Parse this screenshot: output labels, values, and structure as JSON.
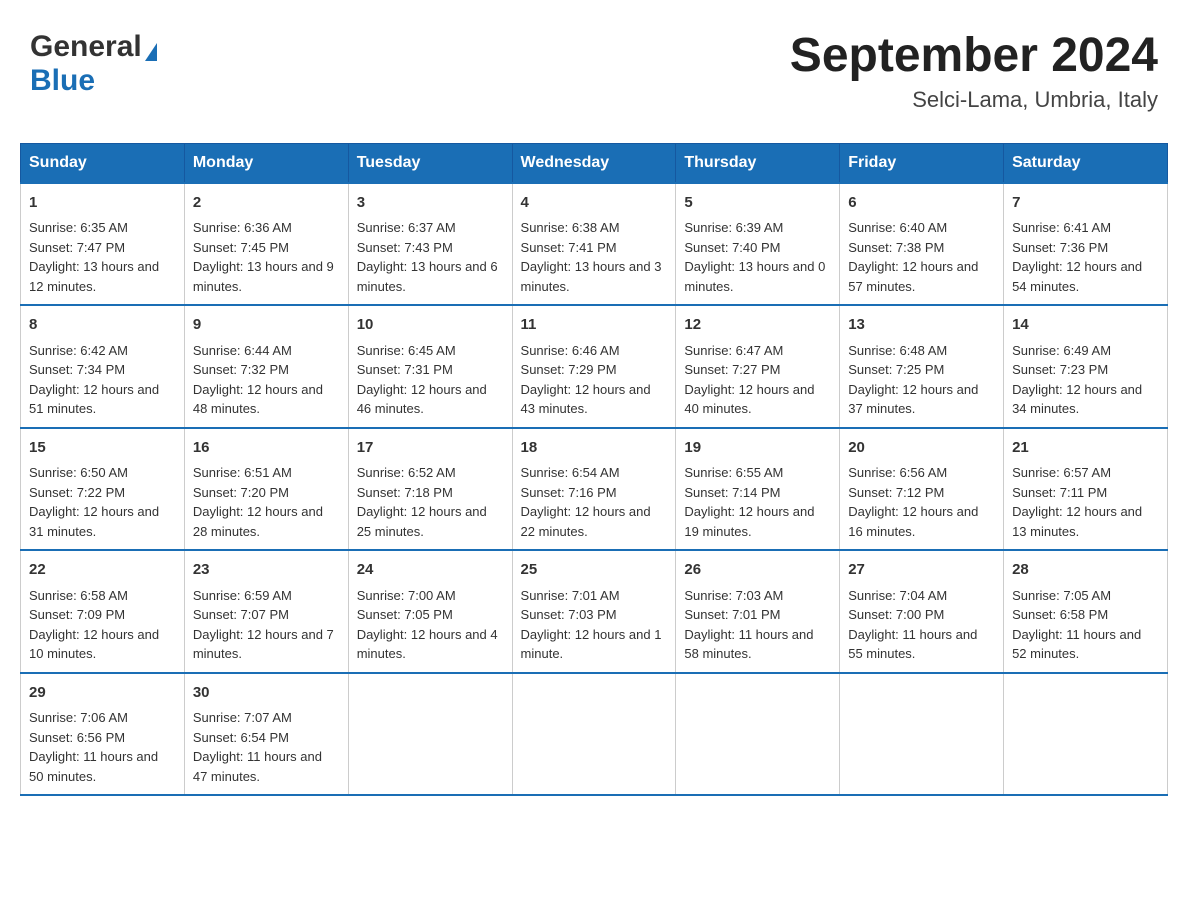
{
  "header": {
    "logo_general": "General",
    "logo_blue": "Blue",
    "month_title": "September 2024",
    "location": "Selci-Lama, Umbria, Italy"
  },
  "calendar": {
    "days_of_week": [
      "Sunday",
      "Monday",
      "Tuesday",
      "Wednesday",
      "Thursday",
      "Friday",
      "Saturday"
    ],
    "weeks": [
      [
        {
          "day": "1",
          "sunrise": "Sunrise: 6:35 AM",
          "sunset": "Sunset: 7:47 PM",
          "daylight": "Daylight: 13 hours and 12 minutes."
        },
        {
          "day": "2",
          "sunrise": "Sunrise: 6:36 AM",
          "sunset": "Sunset: 7:45 PM",
          "daylight": "Daylight: 13 hours and 9 minutes."
        },
        {
          "day": "3",
          "sunrise": "Sunrise: 6:37 AM",
          "sunset": "Sunset: 7:43 PM",
          "daylight": "Daylight: 13 hours and 6 minutes."
        },
        {
          "day": "4",
          "sunrise": "Sunrise: 6:38 AM",
          "sunset": "Sunset: 7:41 PM",
          "daylight": "Daylight: 13 hours and 3 minutes."
        },
        {
          "day": "5",
          "sunrise": "Sunrise: 6:39 AM",
          "sunset": "Sunset: 7:40 PM",
          "daylight": "Daylight: 13 hours and 0 minutes."
        },
        {
          "day": "6",
          "sunrise": "Sunrise: 6:40 AM",
          "sunset": "Sunset: 7:38 PM",
          "daylight": "Daylight: 12 hours and 57 minutes."
        },
        {
          "day": "7",
          "sunrise": "Sunrise: 6:41 AM",
          "sunset": "Sunset: 7:36 PM",
          "daylight": "Daylight: 12 hours and 54 minutes."
        }
      ],
      [
        {
          "day": "8",
          "sunrise": "Sunrise: 6:42 AM",
          "sunset": "Sunset: 7:34 PM",
          "daylight": "Daylight: 12 hours and 51 minutes."
        },
        {
          "day": "9",
          "sunrise": "Sunrise: 6:44 AM",
          "sunset": "Sunset: 7:32 PM",
          "daylight": "Daylight: 12 hours and 48 minutes."
        },
        {
          "day": "10",
          "sunrise": "Sunrise: 6:45 AM",
          "sunset": "Sunset: 7:31 PM",
          "daylight": "Daylight: 12 hours and 46 minutes."
        },
        {
          "day": "11",
          "sunrise": "Sunrise: 6:46 AM",
          "sunset": "Sunset: 7:29 PM",
          "daylight": "Daylight: 12 hours and 43 minutes."
        },
        {
          "day": "12",
          "sunrise": "Sunrise: 6:47 AM",
          "sunset": "Sunset: 7:27 PM",
          "daylight": "Daylight: 12 hours and 40 minutes."
        },
        {
          "day": "13",
          "sunrise": "Sunrise: 6:48 AM",
          "sunset": "Sunset: 7:25 PM",
          "daylight": "Daylight: 12 hours and 37 minutes."
        },
        {
          "day": "14",
          "sunrise": "Sunrise: 6:49 AM",
          "sunset": "Sunset: 7:23 PM",
          "daylight": "Daylight: 12 hours and 34 minutes."
        }
      ],
      [
        {
          "day": "15",
          "sunrise": "Sunrise: 6:50 AM",
          "sunset": "Sunset: 7:22 PM",
          "daylight": "Daylight: 12 hours and 31 minutes."
        },
        {
          "day": "16",
          "sunrise": "Sunrise: 6:51 AM",
          "sunset": "Sunset: 7:20 PM",
          "daylight": "Daylight: 12 hours and 28 minutes."
        },
        {
          "day": "17",
          "sunrise": "Sunrise: 6:52 AM",
          "sunset": "Sunset: 7:18 PM",
          "daylight": "Daylight: 12 hours and 25 minutes."
        },
        {
          "day": "18",
          "sunrise": "Sunrise: 6:54 AM",
          "sunset": "Sunset: 7:16 PM",
          "daylight": "Daylight: 12 hours and 22 minutes."
        },
        {
          "day": "19",
          "sunrise": "Sunrise: 6:55 AM",
          "sunset": "Sunset: 7:14 PM",
          "daylight": "Daylight: 12 hours and 19 minutes."
        },
        {
          "day": "20",
          "sunrise": "Sunrise: 6:56 AM",
          "sunset": "Sunset: 7:12 PM",
          "daylight": "Daylight: 12 hours and 16 minutes."
        },
        {
          "day": "21",
          "sunrise": "Sunrise: 6:57 AM",
          "sunset": "Sunset: 7:11 PM",
          "daylight": "Daylight: 12 hours and 13 minutes."
        }
      ],
      [
        {
          "day": "22",
          "sunrise": "Sunrise: 6:58 AM",
          "sunset": "Sunset: 7:09 PM",
          "daylight": "Daylight: 12 hours and 10 minutes."
        },
        {
          "day": "23",
          "sunrise": "Sunrise: 6:59 AM",
          "sunset": "Sunset: 7:07 PM",
          "daylight": "Daylight: 12 hours and 7 minutes."
        },
        {
          "day": "24",
          "sunrise": "Sunrise: 7:00 AM",
          "sunset": "Sunset: 7:05 PM",
          "daylight": "Daylight: 12 hours and 4 minutes."
        },
        {
          "day": "25",
          "sunrise": "Sunrise: 7:01 AM",
          "sunset": "Sunset: 7:03 PM",
          "daylight": "Daylight: 12 hours and 1 minute."
        },
        {
          "day": "26",
          "sunrise": "Sunrise: 7:03 AM",
          "sunset": "Sunset: 7:01 PM",
          "daylight": "Daylight: 11 hours and 58 minutes."
        },
        {
          "day": "27",
          "sunrise": "Sunrise: 7:04 AM",
          "sunset": "Sunset: 7:00 PM",
          "daylight": "Daylight: 11 hours and 55 minutes."
        },
        {
          "day": "28",
          "sunrise": "Sunrise: 7:05 AM",
          "sunset": "Sunset: 6:58 PM",
          "daylight": "Daylight: 11 hours and 52 minutes."
        }
      ],
      [
        {
          "day": "29",
          "sunrise": "Sunrise: 7:06 AM",
          "sunset": "Sunset: 6:56 PM",
          "daylight": "Daylight: 11 hours and 50 minutes."
        },
        {
          "day": "30",
          "sunrise": "Sunrise: 7:07 AM",
          "sunset": "Sunset: 6:54 PM",
          "daylight": "Daylight: 11 hours and 47 minutes."
        },
        {
          "day": "",
          "sunrise": "",
          "sunset": "",
          "daylight": ""
        },
        {
          "day": "",
          "sunrise": "",
          "sunset": "",
          "daylight": ""
        },
        {
          "day": "",
          "sunrise": "",
          "sunset": "",
          "daylight": ""
        },
        {
          "day": "",
          "sunrise": "",
          "sunset": "",
          "daylight": ""
        },
        {
          "day": "",
          "sunrise": "",
          "sunset": "",
          "daylight": ""
        }
      ]
    ]
  }
}
